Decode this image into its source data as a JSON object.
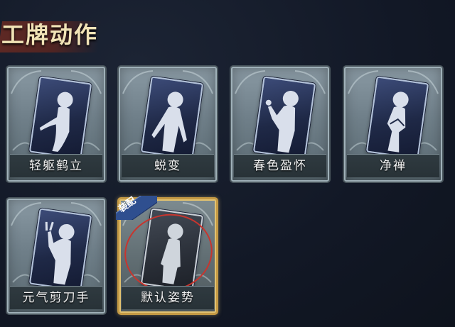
{
  "header": {
    "title": "工牌动作"
  },
  "cards": [
    {
      "label": "轻躯鹤立",
      "pose": "crane",
      "equipped": false
    },
    {
      "label": "蜕变",
      "pose": "open",
      "equipped": false
    },
    {
      "label": "春色盈怀",
      "pose": "flower",
      "equipped": false
    },
    {
      "label": "净禅",
      "pose": "zen",
      "equipped": false
    },
    {
      "label": "元气剪刀手",
      "pose": "peace",
      "equipped": false
    },
    {
      "label": "默认姿势",
      "pose": "default",
      "equipped": true,
      "badge": "装配"
    }
  ],
  "colors": {
    "equipped_border": "#c49a45",
    "badge": "#2f4f8f",
    "highlight_circle": "#c8352e"
  }
}
